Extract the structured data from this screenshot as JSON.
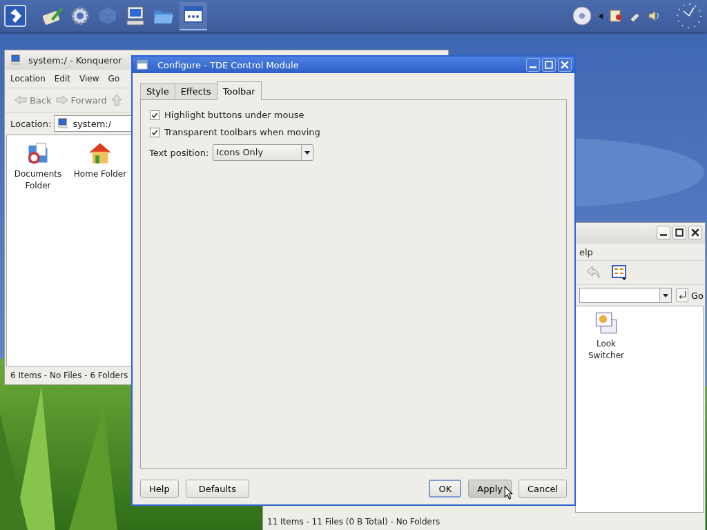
{
  "konqueror": {
    "title": "system:/ - Konqueror",
    "menu": [
      "Location",
      "Edit",
      "View",
      "Go"
    ],
    "toolbar": [
      "Back",
      "Forward"
    ],
    "location_label": "Location:",
    "location": "system:/",
    "items": [
      {
        "label": "Documents Folder",
        "kind": "documents"
      },
      {
        "label": "Home Folder",
        "kind": "home"
      }
    ],
    "status": "6 Items - No Files - 6 Folders"
  },
  "dialog": {
    "title": "Configure - TDE Control Module",
    "tabs": [
      {
        "label": "Style",
        "selected": false
      },
      {
        "label": "Effects",
        "selected": false
      },
      {
        "label": "Toolbar",
        "selected": true
      }
    ],
    "options": [
      {
        "label": "Highlight buttons under mouse",
        "checked": true
      },
      {
        "label": "Transparent toolbars when moving",
        "checked": true
      }
    ],
    "text_position": {
      "label": "Text position:",
      "value": "Icons Only"
    },
    "buttons_left": [
      "Help",
      "Defaults"
    ],
    "buttons_right": [
      {
        "label": "OK",
        "default": true,
        "hovered": false
      },
      {
        "label": "Apply",
        "default": false,
        "hovered": true
      },
      {
        "label": "Cancel",
        "default": false,
        "hovered": false
      }
    ]
  },
  "second_window": {
    "menu_fragment": "elp",
    "go": "Go",
    "items": [
      {
        "label": "Look Switcher"
      }
    ],
    "status": "11 Items - 11 Files (0 B Total) - No Folders"
  }
}
